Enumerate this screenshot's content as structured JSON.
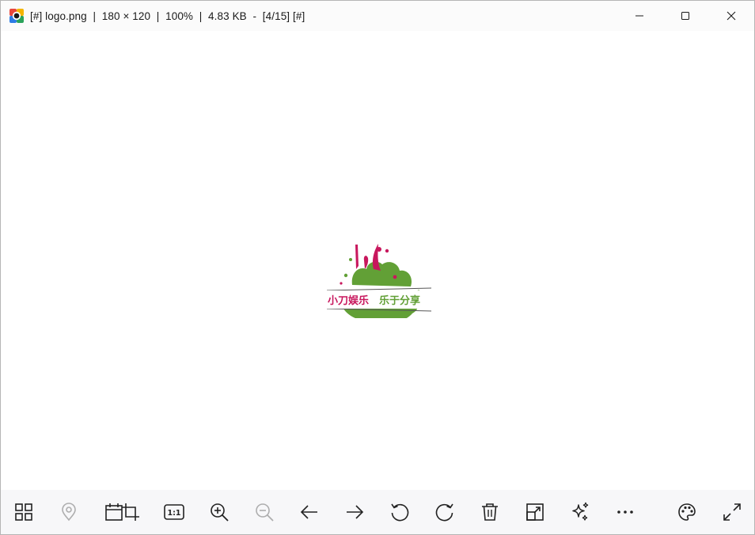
{
  "window": {
    "title": "[#] logo.png  |  180 × 120  |  100%  |  4.83 KB  -  [4/15] [#]",
    "controls": [
      "minimize",
      "maximize",
      "close"
    ]
  },
  "image": {
    "caption_left": "小刀娱乐",
    "caption_right": "乐于分享",
    "colors": {
      "green": "#62a036",
      "magenta": "#c8175d",
      "line": "#555555"
    }
  },
  "toolbar": {
    "buttons": [
      {
        "icon": "gallery-grid-icon",
        "enabled": true
      },
      {
        "icon": "location-pin-icon",
        "enabled": false
      },
      {
        "icon": "calendar-icon",
        "enabled": true
      },
      {
        "icon": "crop-icon",
        "enabled": true
      },
      {
        "icon": "actual-size-icon",
        "label": "1:1",
        "enabled": true
      },
      {
        "icon": "zoom-in-icon",
        "enabled": true
      },
      {
        "icon": "zoom-out-icon",
        "enabled": false
      },
      {
        "icon": "arrow-left-icon",
        "enabled": true
      },
      {
        "icon": "arrow-right-icon",
        "enabled": true
      },
      {
        "icon": "rotate-left-icon",
        "enabled": true
      },
      {
        "icon": "rotate-right-icon",
        "enabled": true
      },
      {
        "icon": "trash-icon",
        "enabled": true
      },
      {
        "icon": "resize-icon",
        "enabled": true
      },
      {
        "icon": "sparkles-icon",
        "enabled": true
      },
      {
        "icon": "more-icon",
        "enabled": true
      },
      {
        "icon": "palette-icon",
        "enabled": true
      },
      {
        "icon": "fullscreen-icon",
        "enabled": true
      }
    ]
  }
}
